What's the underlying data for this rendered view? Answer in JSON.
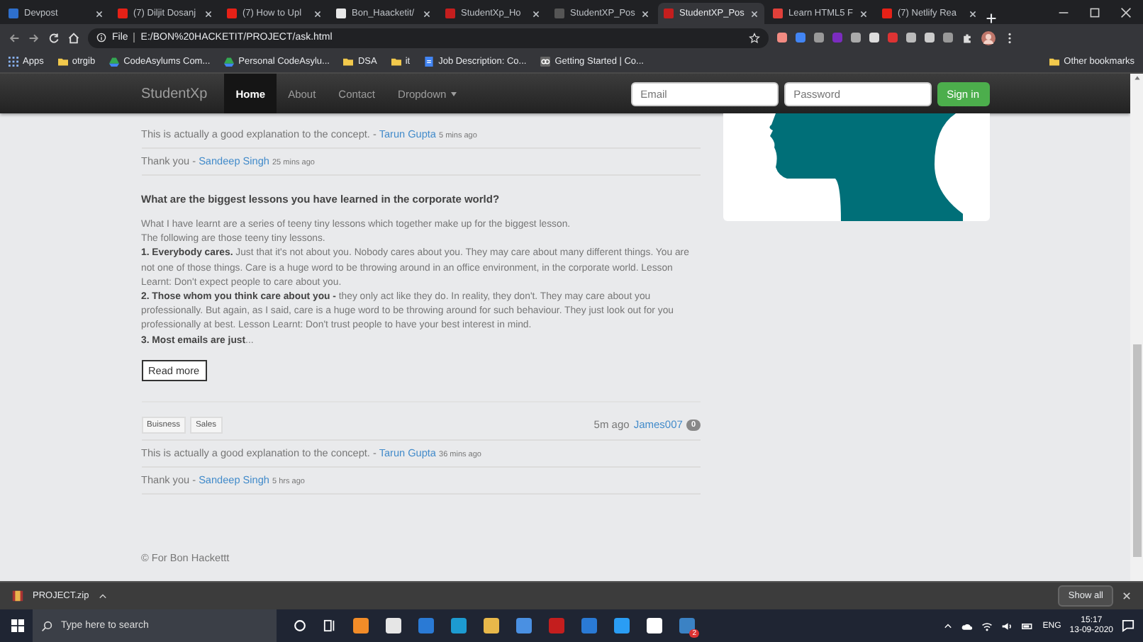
{
  "browser": {
    "tabs": [
      {
        "title": "Devpost",
        "selected": false,
        "color": "#2e6fcc"
      },
      {
        "title": "(7) Diljit Dosanj",
        "selected": false,
        "color": "#e62117"
      },
      {
        "title": "(7) How to Upl",
        "selected": false,
        "color": "#e62117"
      },
      {
        "title": "Bon_Haacketit/",
        "selected": false,
        "color": "#e8e8e8"
      },
      {
        "title": "StudentXp_Ho",
        "selected": false,
        "color": "#c41e1e"
      },
      {
        "title": "StudentXP_Pos",
        "selected": false,
        "color": "#555555"
      },
      {
        "title": "StudentXP_Pos",
        "selected": true,
        "color": "#c41e1e"
      },
      {
        "title": "Learn HTML5 F",
        "selected": false,
        "color": "#e0403a"
      },
      {
        "title": "(7) Netlify Rea",
        "selected": false,
        "color": "#e62117"
      }
    ],
    "file_label": "File",
    "address": "E:/BON%20HACKETIT/PROJECT/ask.html",
    "bookmarks": [
      {
        "label": "Apps",
        "kind": "apps"
      },
      {
        "label": "otrgib",
        "kind": "folder"
      },
      {
        "label": "CodeAsylums Com...",
        "kind": "drive"
      },
      {
        "label": "Personal CodeAsylu...",
        "kind": "drive"
      },
      {
        "label": "DSA",
        "kind": "folder"
      },
      {
        "label": "it",
        "kind": "folder"
      },
      {
        "label": "Job Description: Co...",
        "kind": "doc"
      },
      {
        "label": "Getting Started | Co...",
        "kind": "cc"
      }
    ],
    "other_bookmarks": "Other bookmarks"
  },
  "navbar": {
    "brand": "StudentXp",
    "links": [
      {
        "label": "Home",
        "selected": true
      },
      {
        "label": "About",
        "selected": false
      },
      {
        "label": "Contact",
        "selected": false
      }
    ],
    "dropdown": "Dropdown",
    "email": {
      "placeholder": "Email"
    },
    "password": {
      "placeholder": "Password"
    },
    "sign_in": "Sign in"
  },
  "previous_comments": [
    {
      "text": "This is actually a good explanation to the concept. -",
      "author": "Tarun Gupta",
      "time": "5 mins ago"
    },
    {
      "text": "Thank you -",
      "author": "Sandeep Singh",
      "time": "25 mins ago"
    }
  ],
  "post": {
    "question": "What are the biggest lessons you have learned in the corporate world?",
    "body": [
      "What I have learnt are a series of teeny tiny lessons which together make up for the biggest lesson.",
      "The following are those teeny tiny lessons.",
      "**1. Everybody cares.** Just that it's not about you. Nobody cares about you. They may care about many different things. You are not one of those things. Care is a huge word to be throwing around in an office environment, in the corporate world. Lesson Learnt: Don't expect people to care about you.",
      "**2. Those whom you think care about you -** they only act like they do. In reality, they don't. They may care about you professionally. But again, as I said, care is a huge word to be throwing around for such behaviour. They just look out for you professionally at best. Lesson Learnt: Don't trust people to have your best interest in mind.",
      "**3. Most emails are just**..."
    ],
    "read_more": "Read more",
    "tags": [
      "Buisness",
      "Sales"
    ],
    "time": "5m ago",
    "author": "James007",
    "count": "0",
    "comments": [
      {
        "text": "This is actually a good explanation to the concept. -",
        "author": "Tarun Gupta",
        "time": "36 mins ago"
      },
      {
        "text": "Thank you -",
        "author": "Sandeep Singh",
        "time": "5 hrs ago"
      }
    ]
  },
  "footer": "© For Bon Hackettt",
  "download_bar": {
    "file": "PROJECT.zip",
    "show_all": "Show all"
  },
  "taskbar": {
    "search": {
      "placeholder": "Type here to search"
    },
    "language": "ENG",
    "time": "15:17",
    "date": "13-09-2020",
    "edge_badge": "2"
  }
}
